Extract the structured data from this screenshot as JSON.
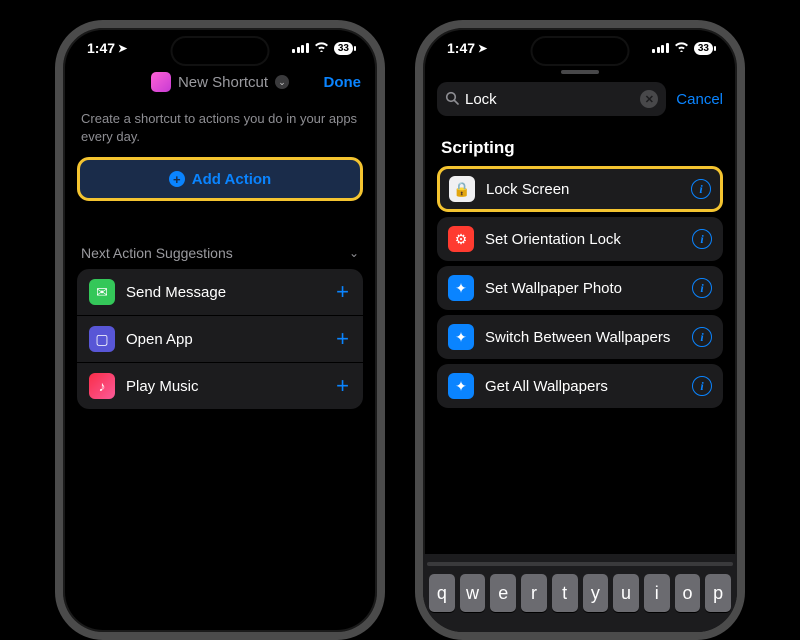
{
  "status": {
    "time": "1:47",
    "battery": "33"
  },
  "left": {
    "title": "New Shortcut",
    "done": "Done",
    "subtitle": "Create a shortcut to actions you do in your apps every day.",
    "add_action": "Add Action",
    "suggestions_header": "Next Action Suggestions",
    "suggestions": [
      {
        "label": "Send Message"
      },
      {
        "label": "Open App"
      },
      {
        "label": "Play Music"
      }
    ]
  },
  "right": {
    "search_value": "Lock",
    "cancel": "Cancel",
    "section": "Scripting",
    "actions": [
      {
        "label": "Lock Screen"
      },
      {
        "label": "Set Orientation Lock"
      },
      {
        "label": "Set Wallpaper Photo"
      },
      {
        "label": "Switch Between Wallpapers"
      },
      {
        "label": "Get All Wallpapers"
      }
    ],
    "keys": [
      "q",
      "w",
      "e",
      "r",
      "t",
      "y",
      "u",
      "i",
      "o",
      "p"
    ]
  }
}
